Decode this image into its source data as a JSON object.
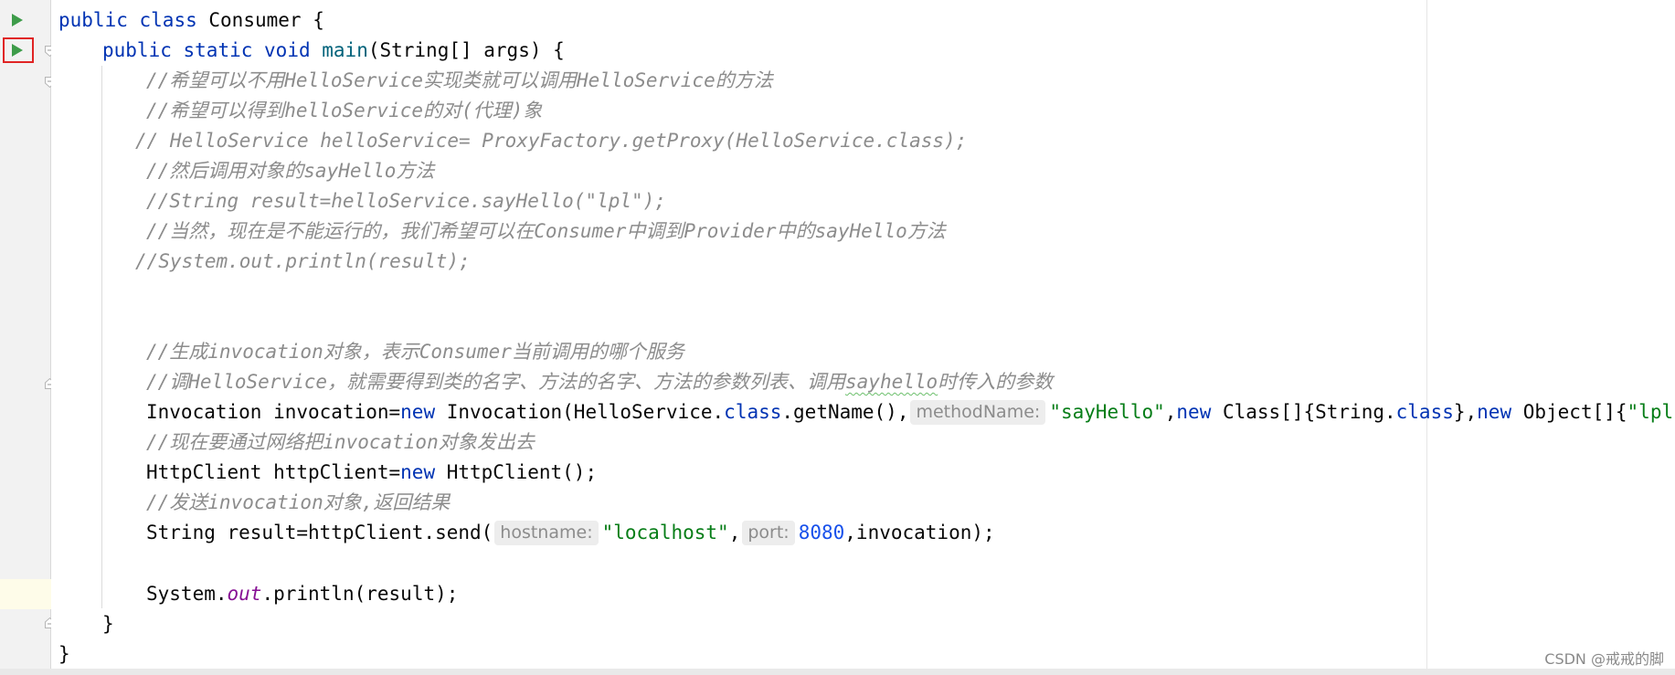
{
  "watermark": "CSDN @戒戒的脚",
  "colors": {
    "keyword": "#0033b3",
    "string": "#067d17",
    "number": "#1750eb",
    "comment": "#8c8c8c",
    "static_field": "#871094",
    "run_icon": "#3e9c4a",
    "run_highlight": "#e02424",
    "current_line": "#fefce9"
  },
  "icons": {
    "run_class": "run-gutter-icon",
    "run_main": "run-gutter-icon",
    "fold": "fold-marker-icon"
  },
  "code": {
    "l1": {
      "kw1": "public",
      "kw2": "class",
      "name": "Consumer",
      "brace": "{"
    },
    "l2": {
      "kw1": "public",
      "kw2": "static",
      "kw3": "void",
      "fn": "main",
      "rest": "(String[] args) {"
    },
    "l3": "//希望可以不用HelloService实现类就可以调用HelloService的方法",
    "l4": "//希望可以得到helloService的对(代理)象",
    "l5": "// HelloService helloService= ProxyFactory.getProxy(HelloService.class);",
    "l6": "//然后调用对象的sayHello方法",
    "l7": "//String result=helloService.sayHello(\"lpl\");",
    "l8": "//当然，现在是不能运行的，我们希望可以在Consumer中调到Provider中的sayHello方法",
    "l9": "//System.out.println(result);",
    "l12": "//生成invocation对象，表示Consumer当前调用的哪个服务",
    "l13": {
      "prefix": "//调HelloService，就需要得到类的名字、方法的名字、方法的参数列表、调用",
      "typo": "sayhello",
      "suffix": "时传入的参数"
    },
    "l14": {
      "a": "Invocation invocation=",
      "new1": "new",
      "b": " Invocation(HelloService.",
      "class1": "class",
      "c": ".getName(),",
      "hint": "methodName:",
      "str1": "\"sayHello\"",
      "d": ",",
      "new2": "new",
      "e": " Class[]{String.",
      "class2": "class",
      "f": "},",
      "new3": "new",
      "g": " Object[]{",
      "str2": "\"lpl\"",
      "h": "});"
    },
    "l15": "//现在要通过网络把invocation对象发出去",
    "l16": {
      "a": "HttpClient httpClient=",
      "new": "new",
      "b": " HttpClient();"
    },
    "l17": "//发送invocation对象,返回结果",
    "l18": {
      "a": "String result=httpClient.send(",
      "hint1": "hostname:",
      "str": "\"localhost\"",
      "b": ",",
      "hint2": "port:",
      "num": "8080",
      "c": ",invocation);"
    },
    "l20": {
      "a": "System.",
      "field": "out",
      "b": ".println(result);"
    },
    "l21": "}",
    "l22": "}"
  }
}
